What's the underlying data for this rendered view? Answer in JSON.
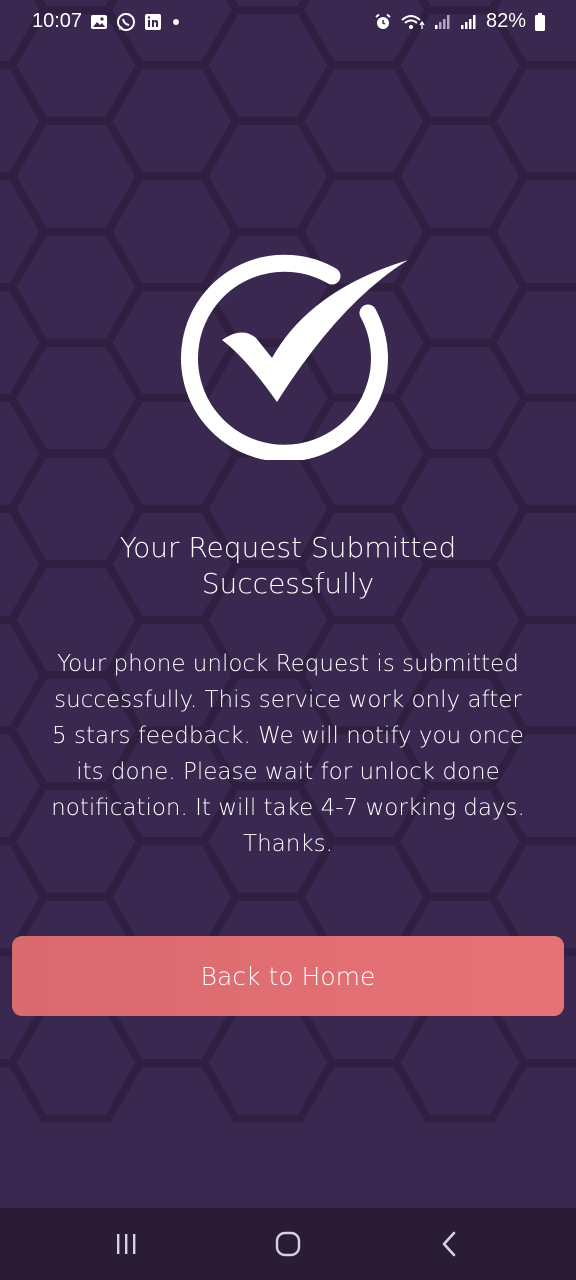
{
  "status_bar": {
    "time": "10:07",
    "left_icons": [
      "gallery-icon",
      "whatsapp-icon",
      "linkedin-icon",
      "dot-icon"
    ],
    "right_icons": [
      "alarm-icon",
      "wifi-icon",
      "signal-icon",
      "signal-icon",
      "battery-icon"
    ],
    "battery": "82%"
  },
  "main": {
    "title_line1": "Your Request Submitted",
    "title_line2": "Successfully",
    "message_lines": [
      "Your phone unlock Request is submitted",
      "successfully. This service work only after",
      "5 stars feedback. We will notify you once",
      "its done. Please wait for unlock done",
      "notification. It will take 4-7 working days.",
      "Thanks."
    ],
    "back_button_label": "Back to Home"
  },
  "nav_bar": {
    "items": [
      "recents-icon",
      "home-icon",
      "back-icon"
    ]
  },
  "colors": {
    "background": "#3b2850",
    "hex_lines": "#2f1f40",
    "button": "#e06d72",
    "nav_bar": "#2a1c34"
  }
}
